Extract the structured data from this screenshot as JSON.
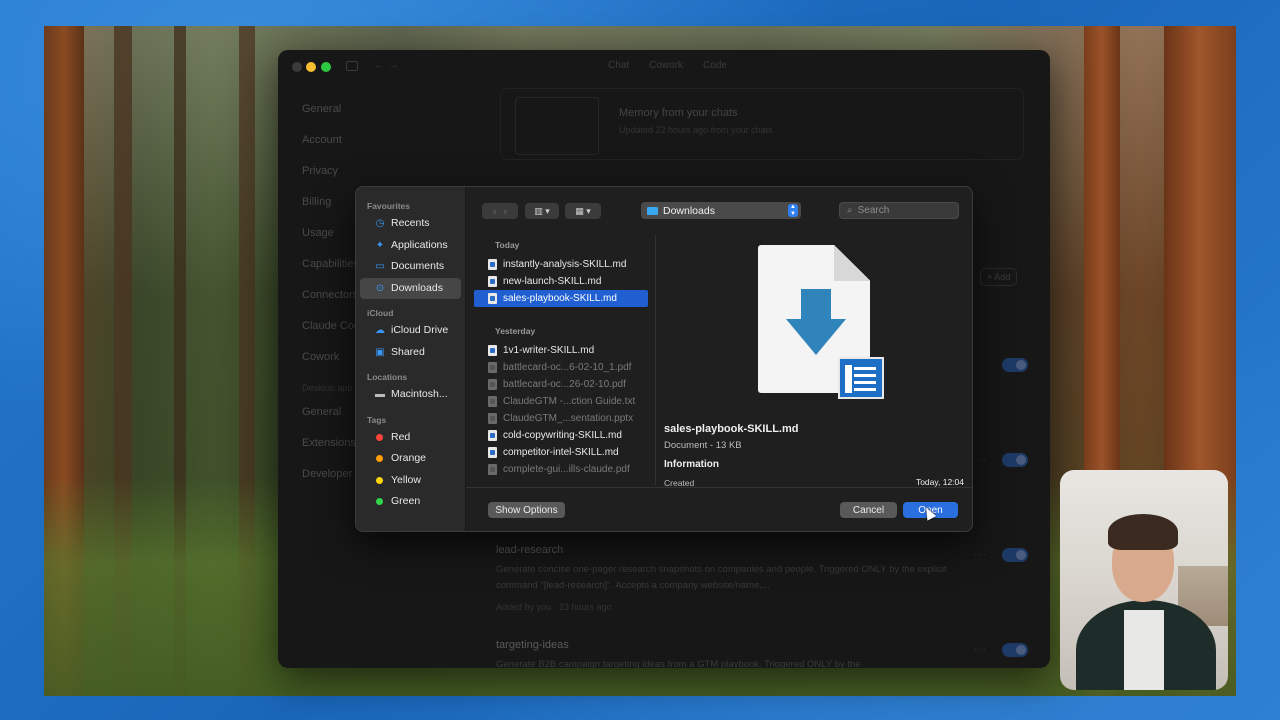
{
  "app": {
    "tabs": [
      "Chat",
      "Cowork",
      "Code"
    ],
    "settings_nav": [
      {
        "label": "General",
        "type": "item"
      },
      {
        "label": "Account",
        "type": "item"
      },
      {
        "label": "Privacy",
        "type": "item"
      },
      {
        "label": "Billing",
        "type": "item"
      },
      {
        "label": "Usage",
        "type": "item"
      },
      {
        "label": "Capabilities",
        "type": "item"
      },
      {
        "label": "Connectors",
        "type": "item"
      },
      {
        "label": "Claude Code",
        "type": "item"
      },
      {
        "label": "Cowork",
        "type": "item"
      },
      {
        "label": "Desktop app",
        "type": "section"
      },
      {
        "label": "General",
        "type": "item"
      },
      {
        "label": "Extensions",
        "type": "item"
      },
      {
        "label": "Developer",
        "type": "item"
      }
    ],
    "memory": {
      "title": "Memory from your chats",
      "subtitle": "Updated 22 hours ago from your chats"
    },
    "add_label": "+ Add",
    "skills": [
      {
        "name": "lead-research",
        "description": "Generate concise one-pager research snapshots on companies and people. Triggered ONLY by the explicit command \"[lead-research]\". Accepts a company website/name,...",
        "meta": "Added by you · 23 hours ago"
      },
      {
        "name": "targeting-ideas",
        "description": "Generate B2B campaign targeting ideas from a GTM playbook. Triggered ONLY by the",
        "meta": ""
      }
    ]
  },
  "dialog": {
    "sidebar": {
      "favourites_heading": "Favourites",
      "favourites": [
        {
          "label": "Recents",
          "icon": "clock-icon"
        },
        {
          "label": "Applications",
          "icon": "applications-icon"
        },
        {
          "label": "Documents",
          "icon": "document-icon"
        },
        {
          "label": "Downloads",
          "icon": "download-icon",
          "active": true
        }
      ],
      "icloud_heading": "iCloud",
      "icloud": [
        {
          "label": "iCloud Drive",
          "icon": "cloud-icon"
        },
        {
          "label": "Shared",
          "icon": "shared-folder-icon"
        }
      ],
      "locations_heading": "Locations",
      "locations": [
        {
          "label": "Macintosh...",
          "icon": "disk-icon"
        }
      ],
      "tags_heading": "Tags",
      "tags": [
        {
          "label": "Red",
          "color": "#ff453a"
        },
        {
          "label": "Orange",
          "color": "#ff9f0a"
        },
        {
          "label": "Yellow",
          "color": "#ffd60a"
        },
        {
          "label": "Green",
          "color": "#32d74b"
        }
      ]
    },
    "toolbar": {
      "location": "Downloads",
      "search_placeholder": "Search"
    },
    "file_groups": [
      {
        "heading": "Today",
        "files": [
          {
            "name": "instantly-analysis-SKILL.md",
            "enabled": true,
            "selected": false
          },
          {
            "name": "new-launch-SKILL.md",
            "enabled": true,
            "selected": false
          },
          {
            "name": "sales-playbook-SKILL.md",
            "enabled": true,
            "selected": true
          }
        ]
      },
      {
        "heading": "Yesterday",
        "files": [
          {
            "name": "1v1-writer-SKILL.md",
            "enabled": true,
            "selected": false
          },
          {
            "name": "battlecard-oc...6-02-10_1.pdf",
            "enabled": false,
            "selected": false
          },
          {
            "name": "battlecard-oc...26-02-10.pdf",
            "enabled": false,
            "selected": false
          },
          {
            "name": "ClaudeGTM -...ction Guide.txt",
            "enabled": false,
            "selected": false
          },
          {
            "name": "ClaudeGTM_...sentation.pptx",
            "enabled": false,
            "selected": false
          },
          {
            "name": "cold-copywriting-SKILL.md",
            "enabled": true,
            "selected": false
          },
          {
            "name": "competitor-intel-SKILL.md",
            "enabled": true,
            "selected": false
          },
          {
            "name": "complete-gui...ills-claude.pdf",
            "enabled": false,
            "selected": false
          }
        ]
      }
    ],
    "preview": {
      "name": "sales-playbook-SKILL.md",
      "kind": "Document - 13 KB",
      "info_heading": "Information",
      "created_label": "Created",
      "created_value": "Today, 12:04"
    },
    "buttons": {
      "show_options": "Show Options",
      "cancel": "Cancel",
      "open": "Open"
    }
  }
}
